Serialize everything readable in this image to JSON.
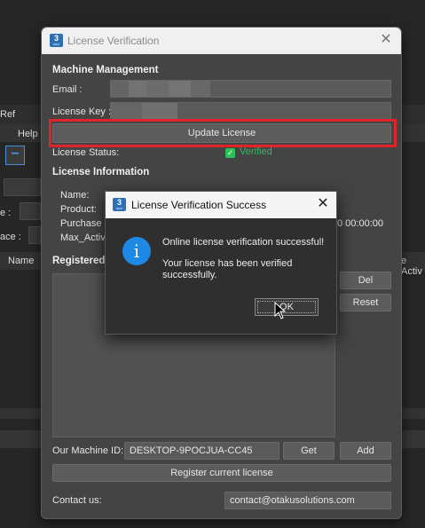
{
  "background": {
    "ref_label": "Ref",
    "help_label": "Help",
    "e_label": "e :",
    "ace_label": "ace :",
    "name_header": "Name",
    "active_header": "e Activ"
  },
  "window": {
    "title": "License Verification",
    "icon": "app-logo-icon",
    "icon_text": "3",
    "icon_subtext": "MAX",
    "close_icon": "close-icon"
  },
  "machine_management": {
    "heading": "Machine Management",
    "email_label": "Email :",
    "email_value": "",
    "license_key_label": "License Key :",
    "license_key_value": "",
    "update_button": "Update License",
    "status_label": "License Status:",
    "status_value": "Verified",
    "status_color": "#2bbf5a"
  },
  "license_information": {
    "heading": "License Information",
    "name_label": "Name:",
    "product_label": "Product:",
    "purchase_label": "Purchase d",
    "max_active_label": "Max_Activ",
    "date_suffix": "0 00:00:00"
  },
  "registered": {
    "heading": "Registered",
    "del_button": "Del",
    "reset_button": "Reset"
  },
  "machine_id": {
    "label": "Our Machine ID:",
    "value": "DESKTOP-9POCJUA-CC45",
    "get_button": "Get",
    "add_button": "Add",
    "register_button": "Register current license"
  },
  "contact": {
    "label": "Contact us:",
    "value": "contact@otakusolutions.com"
  },
  "dialog": {
    "title": "License Verification Success",
    "message": "Online license verification successful!",
    "sub_message": "Your license has been verified successfully.",
    "ok_button": "OK",
    "info_icon": "info-icon",
    "info_glyph": "i"
  },
  "colors": {
    "highlight": "#e0242a",
    "accent": "#1e88e5"
  }
}
